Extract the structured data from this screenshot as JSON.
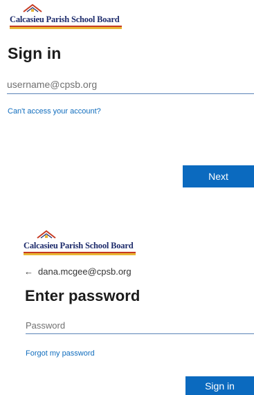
{
  "panel1": {
    "logo": {
      "text": "Calcasieu Parish School Board"
    },
    "title": "Sign in",
    "username_placeholder": "username@cpsb.org",
    "help_link": "Can't access your account?",
    "next_button": "Next"
  },
  "panel2": {
    "logo": {
      "text": "Calcasieu Parish School Board"
    },
    "back_arrow": "←",
    "account_email": "dana.mcgee@cpsb.org",
    "title": "Enter password",
    "password_placeholder": "Password",
    "forgot_link": "Forgot my password",
    "signin_button": "Sign in"
  },
  "colors": {
    "accent": "#0b6abf",
    "link": "#0f6cbd",
    "logo_text": "#1d2b6b",
    "logo_bar_red": "#c63a22",
    "logo_bar_gold": "#e9b634"
  },
  "icons": {
    "school_roof": "school-roof-icon",
    "back": "back-arrow-icon"
  }
}
